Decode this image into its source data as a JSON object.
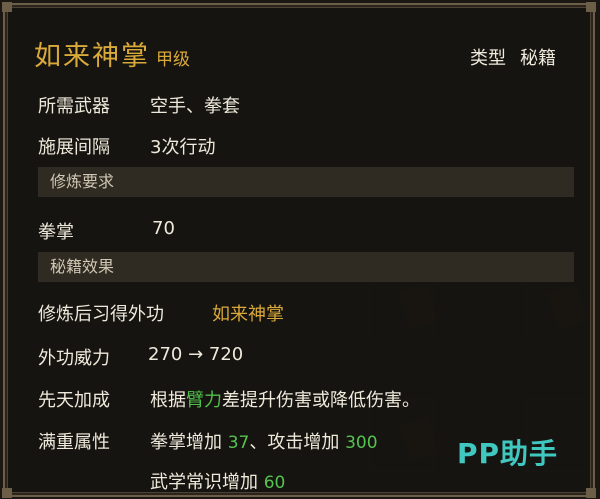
{
  "skill": {
    "name": "如来神掌",
    "grade": "甲级"
  },
  "type": {
    "label": "类型",
    "value": "秘籍"
  },
  "weapon": {
    "label": "所需武器",
    "value": "空手、拳套"
  },
  "interval": {
    "label": "施展间隔",
    "value": "3次行动"
  },
  "req_section": "修炼要求",
  "req": {
    "label": "拳掌",
    "value": "70"
  },
  "effect_section": "秘籍效果",
  "learn": {
    "label": "修炼后习得外功",
    "value": "如来神掌"
  },
  "power": {
    "label": "外功威力",
    "value": "270 → 720"
  },
  "innate": {
    "label": "先天加成",
    "pre": "根据",
    "attr": "臂力",
    "post": "差提升伤害或降低伤害。"
  },
  "maxed": {
    "label": "满重属性",
    "b1_text": "拳掌增加",
    "b1_val": "37",
    "sep": "、",
    "b2_text": "攻击增加",
    "b2_val": "300",
    "b3_text": "武学常识增加",
    "b3_val": "60"
  },
  "watermark": "PP助手"
}
